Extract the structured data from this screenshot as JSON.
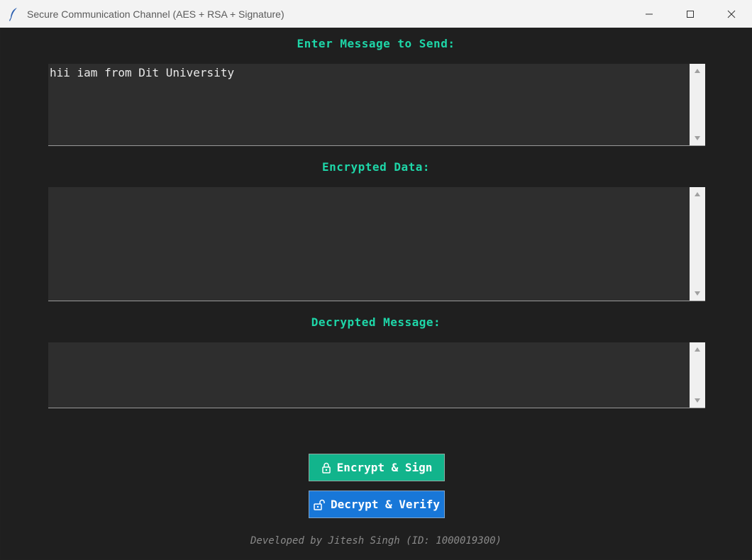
{
  "window": {
    "title": "Secure Communication Channel (AES + RSA + Signature)"
  },
  "labels": {
    "message": "Enter Message to Send:",
    "encrypted": "Encrypted Data:",
    "decrypted": "Decrypted Message:"
  },
  "fields": {
    "message_value": "hii iam from Dit University",
    "encrypted_value": "",
    "decrypted_value": ""
  },
  "buttons": {
    "encrypt_label": "Encrypt & Sign",
    "decrypt_label": "Decrypt & Verify"
  },
  "footer": {
    "credit": "Developed by Jitesh Singh (ID: 1000019300)"
  },
  "colors": {
    "accent_label": "#1ed6a8",
    "encrypt_button": "#12b48c",
    "decrypt_button": "#1877d8",
    "background": "#1f1f1f"
  },
  "icons": {
    "app": "feather-icon",
    "encrypt": "lock-icon",
    "decrypt": "unlock-icon"
  }
}
